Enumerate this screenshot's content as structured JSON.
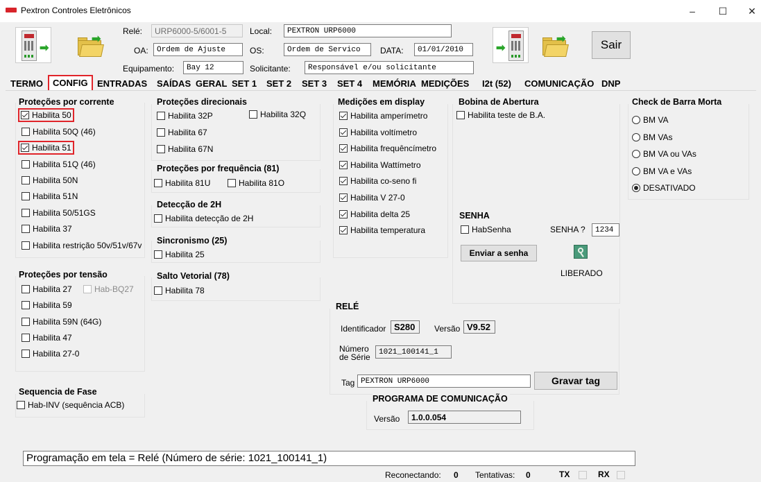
{
  "window": {
    "title": "Pextron Controles Eletrônicos",
    "minimize": "–",
    "maximize": "☐",
    "close": "✕"
  },
  "header": {
    "rele_label": "Relé:",
    "rele_value": "URP6000-5/6001-5",
    "local_label": "Local:",
    "local_value": "PEXTRON URP6000",
    "oa_label": "OA:",
    "oa_value": "Ordem de Ajuste",
    "os_label": "OS:",
    "os_value": "Ordem de Servico",
    "data_label": "DATA:",
    "data_value": "01/01/2010",
    "equip_label": "Equipamento:",
    "equip_value": "Bay 12",
    "solic_label": "Solicitante:",
    "solic_value": "Responsável e/ou solicitante",
    "sair": "Sair"
  },
  "tabs": [
    "TERMO",
    "CONFIG",
    "ENTRADAS",
    "SAÍDAS",
    "GERAL",
    "SET 1",
    "SET 2",
    "SET 3",
    "SET 4",
    "MEMÓRIA",
    "MEDIÇÕES",
    "I2t (52)",
    "COMUNICAÇÃO",
    "DNP"
  ],
  "corrente": {
    "title": "Proteções por corrente",
    "items": [
      {
        "label": "Habilita 50",
        "checked": true
      },
      {
        "label": "Habilita 50Q (46)",
        "checked": false
      },
      {
        "label": "Habilita 51",
        "checked": true
      },
      {
        "label": "Habilita 51Q (46)",
        "checked": false
      },
      {
        "label": "Habilita 50N",
        "checked": false
      },
      {
        "label": "Habilita 51N",
        "checked": false
      },
      {
        "label": "Habilita 50/51GS",
        "checked": false
      },
      {
        "label": "Habilita 37",
        "checked": false
      },
      {
        "label": "Habilita restrição 50v/51v/67v",
        "checked": false
      }
    ]
  },
  "tensao": {
    "title": "Proteções por tensão",
    "items": [
      "Habilita 27",
      "Habilita 59",
      "Habilita 59N (64G)",
      "Habilita 47",
      "Habilita 27-0"
    ],
    "hab_bq27": "Hab-BQ27"
  },
  "fase": {
    "title": "Sequencia de Fase",
    "item": "Hab-INV (sequência ACB)"
  },
  "direcionais": {
    "title": "Proteções direcionais",
    "items": [
      "Habilita 32P",
      "Habilita 32Q",
      "Habilita 67",
      "Habilita 67N"
    ]
  },
  "frequencia": {
    "title": "Proteções por frequência (81)",
    "items": [
      "Habilita 81U",
      "Habilita 81O"
    ]
  },
  "deteccao": {
    "title": "Detecção de 2H",
    "item": "Habilita detecção de 2H"
  },
  "sincronismo": {
    "title": "Sincronismo (25)",
    "item": "Habilita 25"
  },
  "salto": {
    "title": "Salto Vetorial (78)",
    "item": "Habilita 78"
  },
  "medicoes": {
    "title": "Medições em display",
    "items": [
      "Habilita amperímetro",
      "Habilita voltímetro",
      "Habilita frequêncímetro",
      "Habilita Wattímetro",
      "Habilita co-seno fi",
      "Habilita V 27-0",
      "Habilita delta 25",
      "Habilita temperatura"
    ]
  },
  "bobina": {
    "title": "Bobina de Abertura",
    "item": "Habilita teste de B.A."
  },
  "senha": {
    "title": "SENHA",
    "hab": "HabSenha",
    "senha_label": "SENHA ?",
    "senha_value": "1234",
    "enviar": "Enviar a senha",
    "status": "LIBERADO"
  },
  "barra": {
    "title": "Check de Barra Morta",
    "options": [
      {
        "label": "BM VA",
        "selected": false
      },
      {
        "label": "BM VAs",
        "selected": false
      },
      {
        "label": "BM VA ou VAs",
        "selected": false
      },
      {
        "label": "BM VA e VAs",
        "selected": false
      },
      {
        "label": "DESATIVADO",
        "selected": true
      }
    ]
  },
  "rele": {
    "title": "RELÉ",
    "ident_label": "Identificador",
    "ident_value": "S280",
    "versao_label": "Versão",
    "versao_value": "V9.52",
    "serie_label1": "Número",
    "serie_label2": "de Série",
    "serie_value": "1021_100141_1",
    "tag_label": "Tag",
    "tag_value": "PEXTRON URP6000",
    "gravar": "Gravar tag"
  },
  "programa": {
    "title": "PROGRAMA DE COMUNICAÇÃO",
    "versao_label": "Versão",
    "versao_value": "1.0.0.054"
  },
  "status": {
    "message": "Programação em tela = Relé (Número de série: 1021_100141_1)",
    "reconectando_label": "Reconectando:",
    "reconectando_value": "0",
    "tentativas_label": "Tentativas:",
    "tentativas_value": "0",
    "tx": "TX",
    "rx": "RX"
  },
  "colors": {
    "highlight": "#e0242a"
  }
}
